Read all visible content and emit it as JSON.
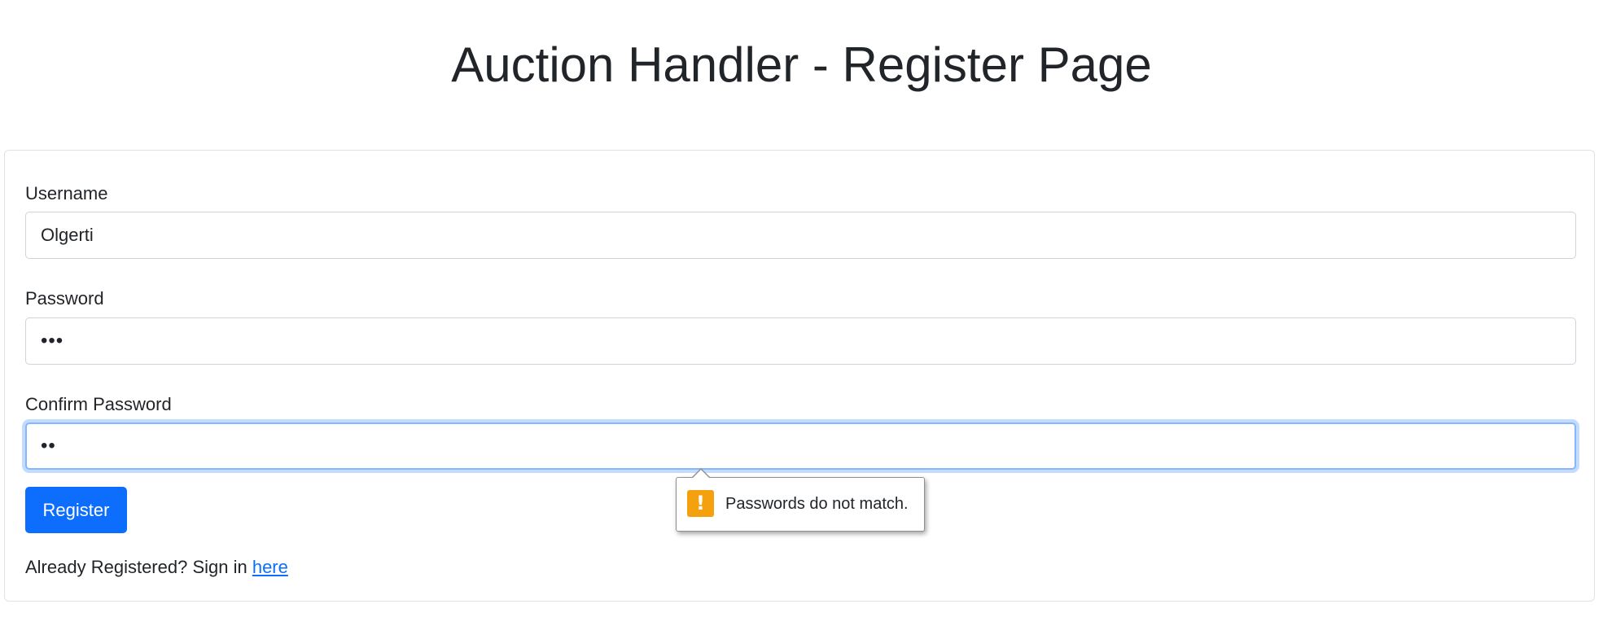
{
  "page": {
    "title": "Auction Handler - Register Page"
  },
  "form": {
    "username_label": "Username",
    "username_value": "Olgerti",
    "password_label": "Password",
    "password_value": "•••",
    "confirm_label": "Confirm Password",
    "confirm_value": "••",
    "register_label": "Register",
    "signin_prefix": "Already Registered? Sign in ",
    "signin_link": "here"
  },
  "validation": {
    "message": "Passwords do not match.",
    "icon": "warning-icon",
    "icon_glyph": "!"
  },
  "colors": {
    "primary": "#0d6efd",
    "warning": "#f5a00f",
    "focus_ring": "#86b7fe"
  }
}
